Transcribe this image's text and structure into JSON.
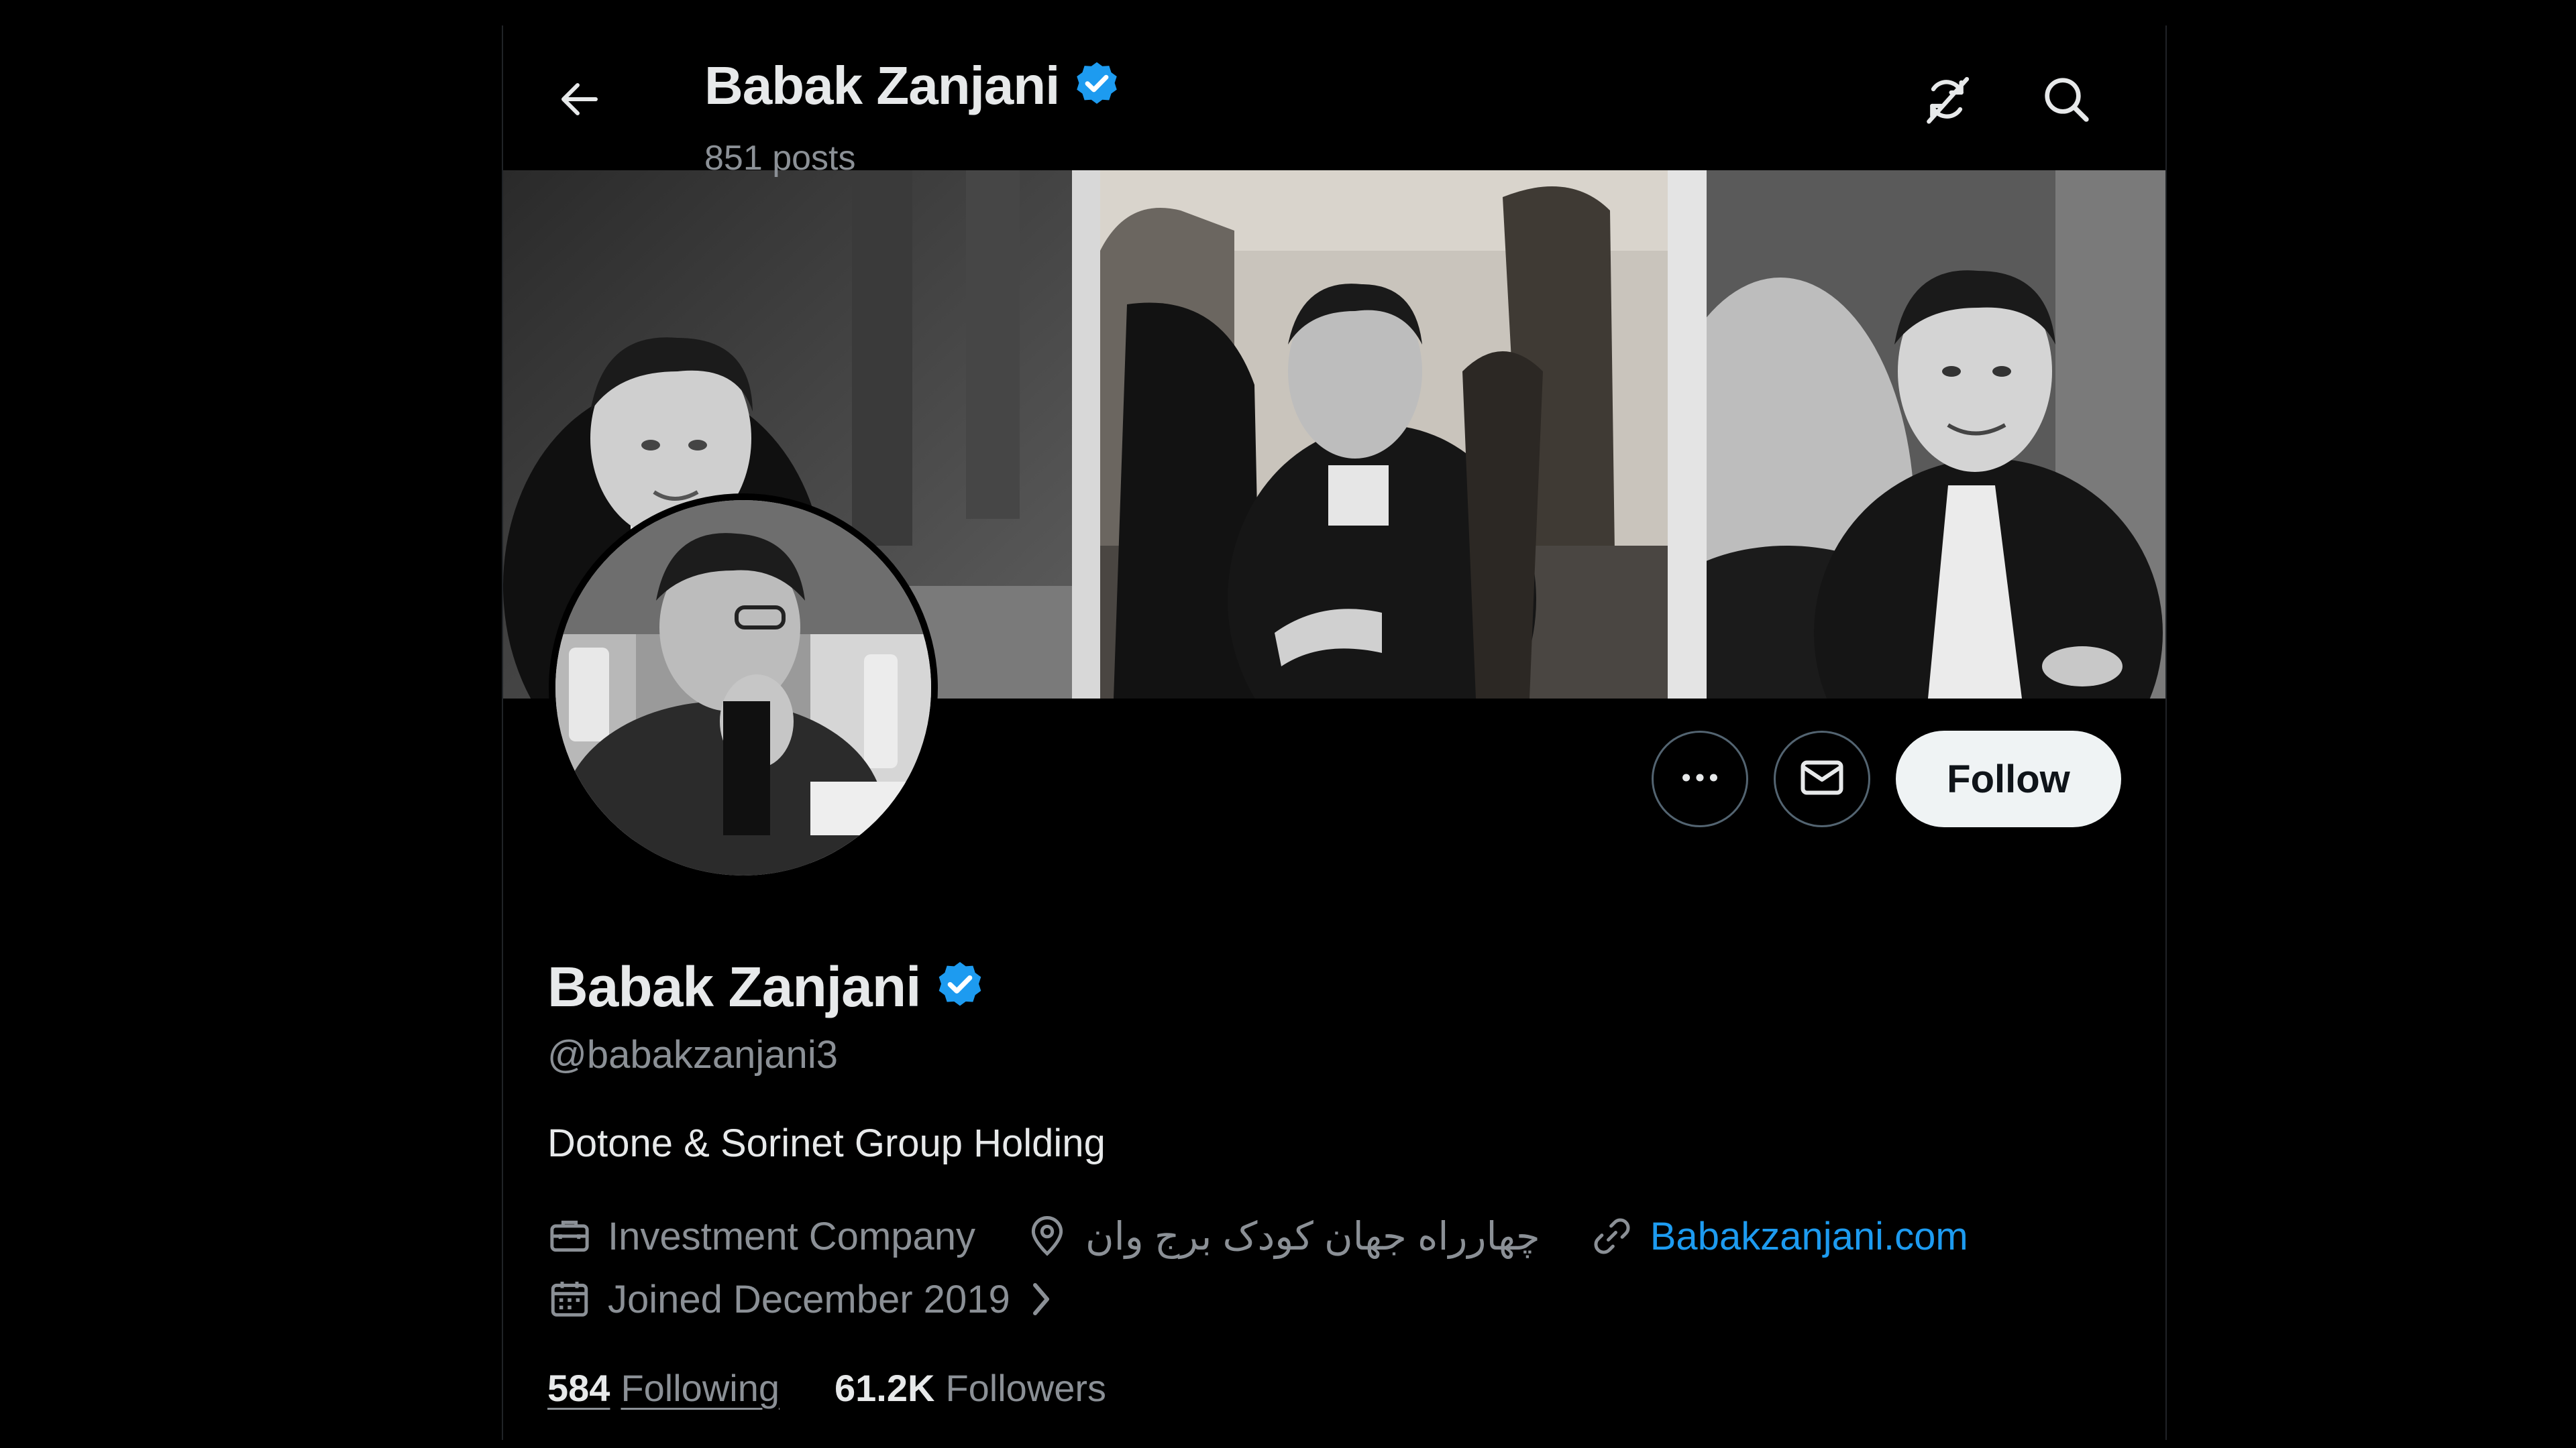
{
  "header": {
    "name": "Babak Zanjani",
    "posts": "851 posts",
    "back_icon": "arrow-left-icon",
    "rss_icon": "rss-off-icon",
    "search_icon": "search-icon"
  },
  "profile": {
    "name": "Babak Zanjani",
    "verified": true,
    "handle": "@babakzanjani3",
    "bio": "Dotone & Sorinet Group Holding",
    "category": "Investment Company",
    "location": "چهارراه جهان کودک برج وان",
    "website": "Babakzanjani.com",
    "joined": "Joined December 2019"
  },
  "actions": {
    "more_icon": "more-dots-icon",
    "message_icon": "envelope-icon",
    "follow_label": "Follow"
  },
  "stats": {
    "following_count": "584",
    "following_label": "Following",
    "followers_count": "61.2K",
    "followers_label": "Followers"
  },
  "colors": {
    "background": "#000000",
    "text_primary": "#e7e9ea",
    "text_secondary": "#8b9096",
    "link": "#1d9bf0",
    "verified_badge": "#1d9bf0",
    "follow_button_bg": "#eff3f4",
    "follow_button_text": "#0f1419",
    "border": "#536471"
  }
}
